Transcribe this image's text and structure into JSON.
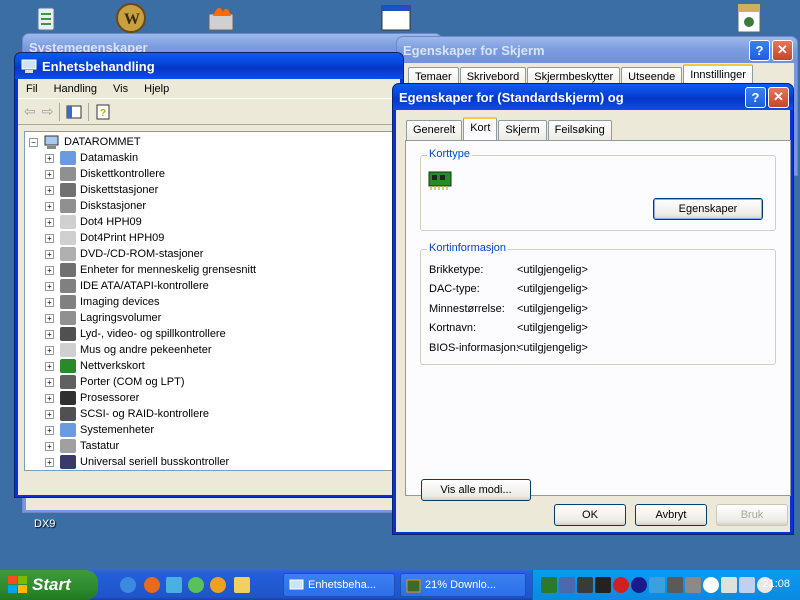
{
  "desktop": {
    "label_dx9": "DX9"
  },
  "sysprops": {
    "title": "Systemegenskaper"
  },
  "devmgr": {
    "title": "Enhetsbehandling",
    "menu": [
      "Fil",
      "Handling",
      "Vis",
      "Hjelp"
    ],
    "root": "DATAROMMET",
    "items": [
      "Datamaskin",
      "Diskettkontrollere",
      "Diskettstasjoner",
      "Diskstasjoner",
      "Dot4 HPH09",
      "Dot4Print HPH09",
      "DVD-/CD-ROM-stasjoner",
      "Enheter for menneskelig grensesnitt",
      "IDE ATA/ATAPI-kontrollere",
      "Imaging devices",
      "Lagringsvolumer",
      "Lyd-, video- og spillkontrollere",
      "Mus og andre pekeenheter",
      "Nettverkskort",
      "Porter (COM og LPT)",
      "Prosessorer",
      "SCSI- og RAID-kontrollere",
      "Systemenheter",
      "Tastatur",
      "Universal seriell busskontroller"
    ]
  },
  "screenprops": {
    "title": "Egenskaper for Skjerm",
    "tabs": [
      "Temaer",
      "Skrivebord",
      "Skjermbeskytter",
      "Utseende",
      "Innstillinger"
    ]
  },
  "dialog": {
    "title": "Egenskaper for (Standardskjerm) og",
    "tabs": [
      "Generelt",
      "Kort",
      "Skjerm",
      "Feilsøking"
    ],
    "active_tab": "Kort",
    "korttype_label": "Korttype",
    "egenskaper_button": "Egenskaper",
    "kortinfo_label": "Kortinformasjon",
    "info": [
      {
        "key": "Brikketype:",
        "value": "<utilgjengelig>"
      },
      {
        "key": "DAC-type:",
        "value": "<utilgjengelig>"
      },
      {
        "key": "Minnestørrelse:",
        "value": "<utilgjengelig>"
      },
      {
        "key": "Kortnavn:",
        "value": "<utilgjengelig>"
      },
      {
        "key": "BIOS-informasjon:",
        "value": "<utilgjengelig>"
      }
    ],
    "vis_alle_button": "Vis alle modi...",
    "ok_button": "OK",
    "avbryt_button": "Avbryt",
    "bruk_button": "Bruk"
  },
  "taskbar": {
    "start_label": "Start",
    "buttons": [
      "Enhetsbeha...",
      "21% Downlo..."
    ],
    "clock": "21:08"
  }
}
